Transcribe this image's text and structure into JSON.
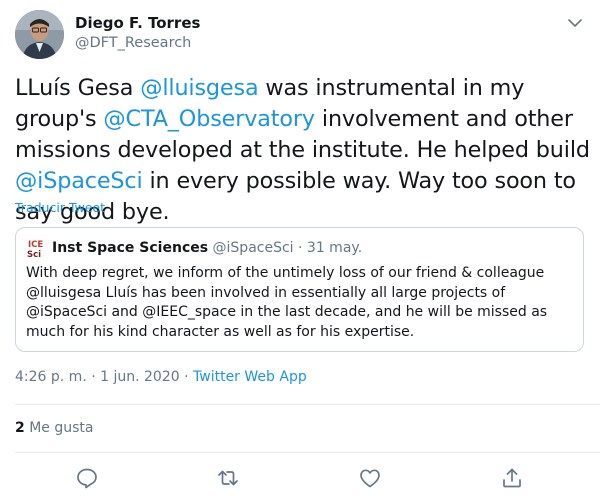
{
  "author": {
    "name": "Diego F. Torres",
    "handle": "@DFT_Research"
  },
  "tweet": {
    "text_parts": [
      {
        "text": "LLuís Gesa "
      },
      {
        "text": "@lluisgesa"
      },
      {
        "text": " was instrumental in my group's "
      },
      {
        "text": "@CTA_Observatory"
      },
      {
        "text": " involvement and other missions developed at the institute. He helped build "
      },
      {
        "text": "@iSpaceSci"
      },
      {
        "text": " in every possible way. Way too soon to say good bye."
      }
    ],
    "translate_label": "Traducir Tweet"
  },
  "quoted": {
    "name": "Inst Space Sciences",
    "handle": "@iSpaceSci",
    "separator": " · ",
    "date": "31 may.",
    "text": "With deep regret, we inform of the untimely loss of our friend & colleague @lluisgesa Lluís has been involved in essentially all large projects of @iSpaceSci and @IEEC_space in the last decade, and he will be missed as much for his kind character as well as for his expertise."
  },
  "meta": {
    "time": "4:26 p. m.",
    "sep": " · ",
    "date": "1 jun. 2020",
    "source": "Twitter Web App"
  },
  "likes": {
    "count": "2",
    "label": "Me gusta"
  },
  "icons": {
    "menu": "chevron-down-icon",
    "reply": "reply-icon",
    "retweet": "retweet-icon",
    "like": "heart-icon",
    "share": "share-icon"
  },
  "colors": {
    "link": "#1b95e0",
    "secondary": "#657786",
    "text": "#14171a",
    "border": "#ccd6dd"
  }
}
